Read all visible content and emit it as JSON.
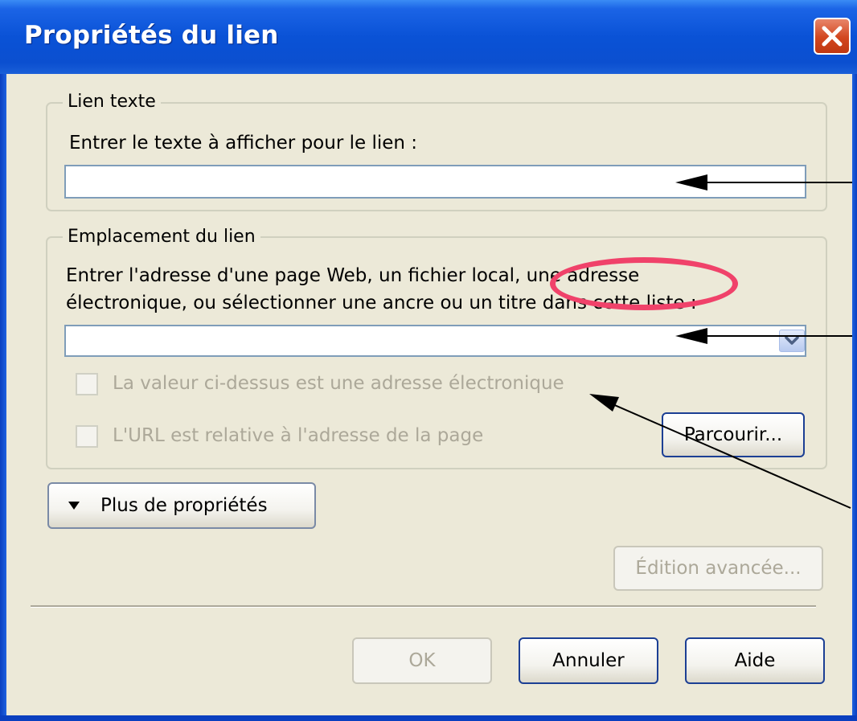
{
  "window": {
    "title": "Propriétés du lien",
    "close_icon": "close-x-icon"
  },
  "link_text_group": {
    "legend": "Lien texte",
    "prompt": "Entrer le texte à afficher pour le lien :",
    "input_value": ""
  },
  "link_location_group": {
    "legend": "Emplacement du lien",
    "prompt_line1": "Entrer l'adresse d'une page Web, un fichier local, une adresse",
    "prompt_line2": "électronique, ou sélectionner une ancre ou un titre dans cette liste :",
    "combo_value": "",
    "dropdown_icon": "chevron-down-icon",
    "checkbox_email_label": "La valeur ci-dessus est une adresse électronique",
    "checkbox_email_checked": false,
    "checkbox_relative_label": "L'URL est relative à l'adresse de la page",
    "checkbox_relative_checked": false,
    "browse_button": "Parcourir..."
  },
  "more_properties_button": "Plus de propriétés",
  "advanced_edit_button": "Édition avancée...",
  "footer": {
    "ok_button": "OK",
    "cancel_button": "Annuler",
    "help_button": "Aide"
  },
  "annotation_colors": {
    "highlight": "#f0426a",
    "arrow": "#000000"
  }
}
